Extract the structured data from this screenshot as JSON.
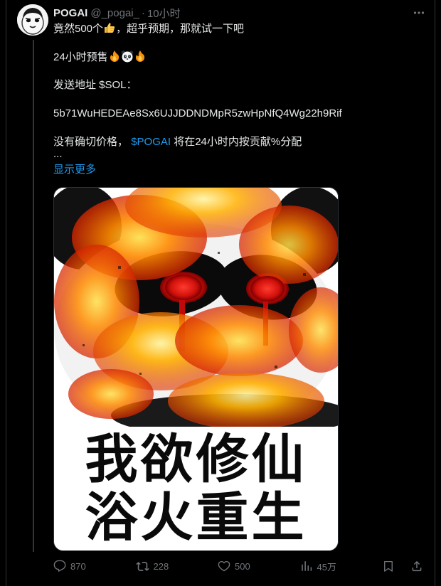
{
  "tweet": {
    "display_name": "POGAI",
    "handle": "@_pogai_",
    "separator": "·",
    "time": "10小时",
    "line1_text": "竟然500个",
    "line1_emoji": "thumbs-up-emoji",
    "line1_rest": "，超乎预期，那就试一下吧",
    "line2_text": "24小时预售",
    "line2_emojis": [
      "fire-emoji",
      "panda-emoji",
      "fire-emoji"
    ],
    "line3": "发送地址 $SOL：",
    "line4": "5b71WuHEDEAe8Sx6UJJDDNDMpR5zwHpNfQ4Wg22h9Rif",
    "line5_before": "没有确切价格，",
    "line5_cashtag": "$POGAI",
    "line5_after": "将在24小时内按贡献%分配",
    "ellipsis": "...",
    "show_more": "显示更多",
    "media": {
      "caption_line1": "我欲修仙",
      "caption_line2": "浴火重生",
      "description_icon": "flaming-panda-meme-image"
    },
    "actions": {
      "reply_count": "870",
      "retweet_count": "228",
      "like_count": "500",
      "views_count": "45万"
    }
  },
  "colors": {
    "background": "#000000",
    "text": "#e7e9ea",
    "muted": "#71767b",
    "link": "#1d9bf0",
    "border": "#2f3336"
  }
}
